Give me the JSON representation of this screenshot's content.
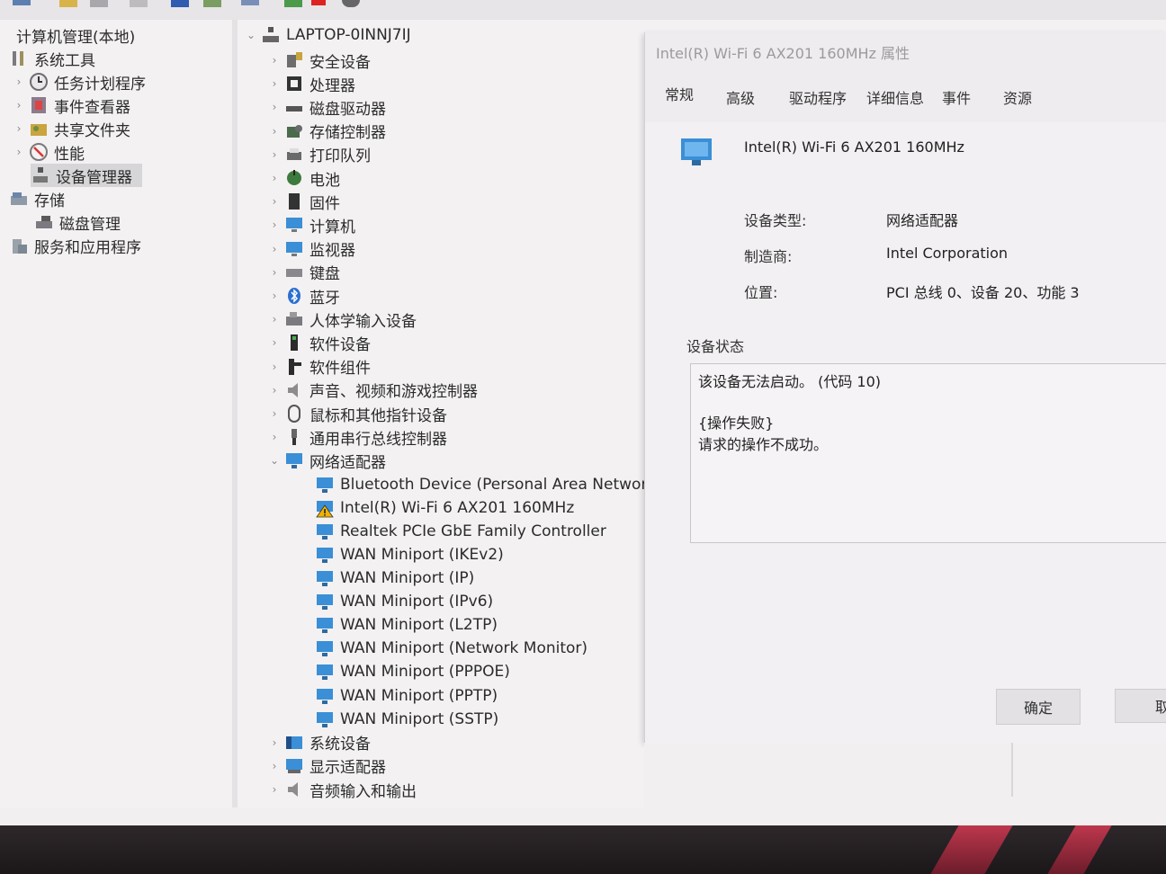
{
  "left_tree": {
    "root": "计算机管理(本地)",
    "items": [
      {
        "label": "系统工具",
        "icon": "tools-icon"
      },
      {
        "label": "任务计划程序",
        "icon": "clock-icon"
      },
      {
        "label": "事件查看器",
        "icon": "event-viewer-icon"
      },
      {
        "label": "共享文件夹",
        "icon": "shared-folder-icon"
      },
      {
        "label": "性能",
        "icon": "performance-icon"
      },
      {
        "label": "设备管理器",
        "icon": "device-manager-icon"
      },
      {
        "label": "存储",
        "icon": "storage-icon"
      },
      {
        "label": "磁盘管理",
        "icon": "disk-management-icon"
      },
      {
        "label": "服务和应用程序",
        "icon": "services-icon"
      }
    ]
  },
  "device_tree": {
    "computer_name": "LAPTOP-0INNJ7IJ",
    "categories": [
      {
        "label": "安全设备",
        "icon": "security-device-icon"
      },
      {
        "label": "处理器",
        "icon": "processor-icon"
      },
      {
        "label": "磁盘驱动器",
        "icon": "disk-drive-icon"
      },
      {
        "label": "存储控制器",
        "icon": "storage-controller-icon"
      },
      {
        "label": "打印队列",
        "icon": "printer-icon"
      },
      {
        "label": "电池",
        "icon": "battery-icon"
      },
      {
        "label": "固件",
        "icon": "firmware-icon"
      },
      {
        "label": "计算机",
        "icon": "computer-icon"
      },
      {
        "label": "监视器",
        "icon": "monitor-icon"
      },
      {
        "label": "键盘",
        "icon": "keyboard-icon"
      },
      {
        "label": "蓝牙",
        "icon": "bluetooth-icon"
      },
      {
        "label": "人体学输入设备",
        "icon": "hid-icon"
      },
      {
        "label": "软件设备",
        "icon": "software-device-icon"
      },
      {
        "label": "软件组件",
        "icon": "software-component-icon"
      },
      {
        "label": "声音、视频和游戏控制器",
        "icon": "speaker-icon"
      },
      {
        "label": "鼠标和其他指针设备",
        "icon": "mouse-icon"
      },
      {
        "label": "通用串行总线控制器",
        "icon": "usb-icon"
      },
      {
        "label": "网络适配器",
        "icon": "network-adapter-icon"
      }
    ],
    "network_adapters": [
      {
        "label": "Bluetooth Device (Personal Area Network)",
        "warning": false
      },
      {
        "label": "Intel(R) Wi-Fi 6 AX201 160MHz",
        "warning": true
      },
      {
        "label": "Realtek PCIe GbE Family Controller",
        "warning": false
      },
      {
        "label": "WAN Miniport (IKEv2)",
        "warning": false
      },
      {
        "label": "WAN Miniport (IP)",
        "warning": false
      },
      {
        "label": "WAN Miniport (IPv6)",
        "warning": false
      },
      {
        "label": "WAN Miniport (L2TP)",
        "warning": false
      },
      {
        "label": "WAN Miniport (Network Monitor)",
        "warning": false
      },
      {
        "label": "WAN Miniport (PPPOE)",
        "warning": false
      },
      {
        "label": "WAN Miniport (PPTP)",
        "warning": false
      },
      {
        "label": "WAN Miniport (SSTP)",
        "warning": false
      }
    ],
    "after_categories": [
      {
        "label": "系统设备",
        "icon": "system-device-icon"
      },
      {
        "label": "显示适配器",
        "icon": "display-adapter-icon"
      },
      {
        "label": "音频输入和输出",
        "icon": "audio-io-icon"
      }
    ]
  },
  "dialog": {
    "title": "Intel(R) Wi-Fi 6 AX201 160MHz 属性",
    "tabs": [
      "常规",
      "高级",
      "驱动程序",
      "详细信息",
      "事件",
      "资源"
    ],
    "device_name": "Intel(R) Wi-Fi 6 AX201 160MHz",
    "device_type_label": "设备类型:",
    "device_type_value": "网络适配器",
    "manufacturer_label": "制造商:",
    "manufacturer_value": "Intel Corporation",
    "location_label": "位置:",
    "location_value": "PCI 总线 0、设备 20、功能 3",
    "status_heading": "设备状态",
    "status_lines": [
      "该设备无法启动。 (代码 10)",
      "{操作失败}",
      "请求的操作不成功。"
    ],
    "ok_label": "确定",
    "cancel_label": "取"
  },
  "colors": {
    "network_icon": "#3a8fd6",
    "warning": "#f2b300",
    "bezel_glow": "#d73a53"
  }
}
